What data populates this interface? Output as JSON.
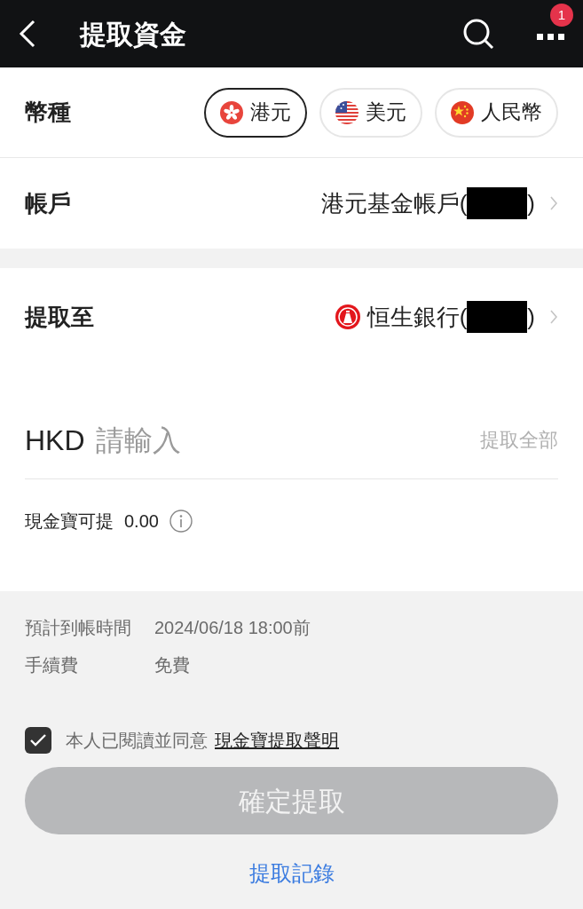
{
  "header": {
    "title": "提取資金",
    "badge": "1"
  },
  "currency": {
    "label": "幣種",
    "options": [
      {
        "kind": "hk",
        "label": "港元",
        "selected": true
      },
      {
        "kind": "us",
        "label": "美元",
        "selected": false
      },
      {
        "kind": "cn",
        "label": "人民幣",
        "selected": false
      }
    ]
  },
  "account": {
    "label": "帳戶",
    "value": "港元基金帳戶(",
    "close": ")"
  },
  "withdraw_to": {
    "label": "提取至",
    "value": "恒生銀行(",
    "close": ")"
  },
  "amount": {
    "currency": "HKD",
    "placeholder": "請輸入",
    "all_button": "提取全部"
  },
  "available": {
    "label": "現金寶可提",
    "value": "0.00"
  },
  "details": [
    {
      "label": "預計到帳時間",
      "value": "2024/06/18 18:00前"
    },
    {
      "label": "手續費",
      "value": "免費"
    }
  ],
  "agreement": {
    "checked": true,
    "text": "本人已閱讀並同意",
    "link": "現金寶提取聲明"
  },
  "confirm": {
    "label": "確定提取",
    "disabled": true
  },
  "history_link": "提取記錄"
}
